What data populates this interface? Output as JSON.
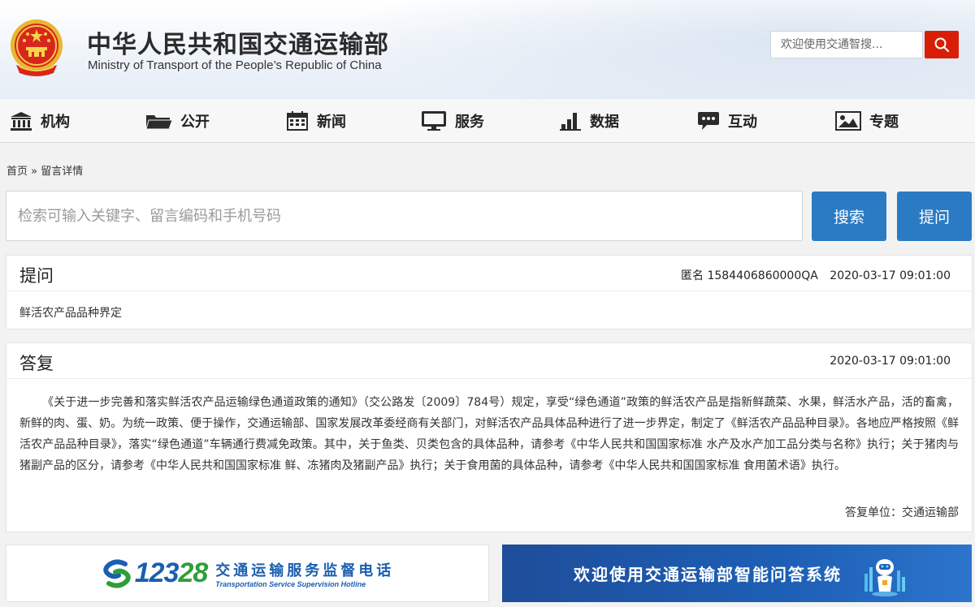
{
  "header": {
    "title": "中华人民共和国交通运输部",
    "subtitle": "Ministry of Transport of the People’s Republic of China",
    "search_placeholder": "欢迎使用交通智搜..."
  },
  "nav": {
    "items": [
      {
        "label": "机构",
        "icon": "institution-icon"
      },
      {
        "label": "公开",
        "icon": "folder-icon"
      },
      {
        "label": "新闻",
        "icon": "calendar-icon"
      },
      {
        "label": "服务",
        "icon": "monitor-icon"
      },
      {
        "label": "数据",
        "icon": "bar-chart-icon"
      },
      {
        "label": "互动",
        "icon": "chat-icon"
      },
      {
        "label": "专题",
        "icon": "image-icon"
      }
    ]
  },
  "breadcrumb": {
    "home": "首页",
    "separator": "»",
    "current": "留言详情"
  },
  "search": {
    "placeholder": "检索可输入关键字、留言编码和手机号码",
    "search_label": "搜索",
    "ask_label": "提问"
  },
  "question": {
    "title": "提问",
    "author": "匿名",
    "code": "1584406860000QA",
    "time": "2020-03-17 09:01:00",
    "content": "鲜活农产品品种界定"
  },
  "answer": {
    "title": "答复",
    "time": "2020-03-17 09:01:00",
    "content": "《关于进一步完善和落实鲜活农产品运输绿色通道政策的通知》（交公路发〔2009〕784号）规定，享受“绿色通道”政策的鲜活农产品是指新鲜蔬菜、水果，鲜活水产品，活的畜禽，新鲜的肉、蛋、奶。为统一政策、便于操作，交通运输部、国家发展改革委经商有关部门，对鲜活农产品具体品种进行了进一步界定，制定了《鲜活农产品品种目录》。各地应严格按照《鲜活农产品品种目录》，落实“绿色通道”车辆通行费减免政策。其中，关于鱼类、贝类包含的具体品种，请参考《中华人民共和国国家标准 水产及水产加工品分类与名称》执行；关于猪肉与猪副产品的区分，请参考《中华人民共和国国家标准 鲜、冻猪肉及猪副产品》执行；关于食用菌的具体品种，请参考《中华人民共和国国家标准 食用菌术语》执行。",
    "unit_label": "答复单位：",
    "unit": "交通运输部"
  },
  "banners": {
    "hotline_number_a": "123",
    "hotline_number_b": "28",
    "hotline_cn": "交通运输服务监督电话",
    "hotline_en": "Transportation Service Supervision Hotline",
    "qa_system": "欢迎使用交通运输部智能问答系统"
  },
  "colors": {
    "accent_red": "#d81e06",
    "button_blue": "#2a7bc4",
    "banner_blue": "#1d5fb5"
  }
}
